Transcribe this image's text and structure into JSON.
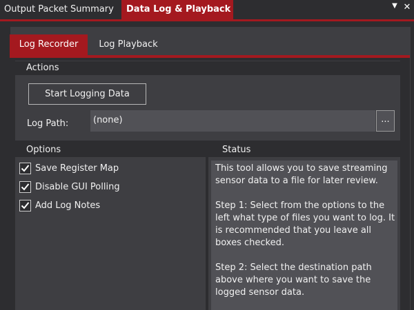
{
  "doc_tabs": [
    {
      "label": "Output Packet Summary",
      "active": false
    },
    {
      "label": "Data Log & Playback",
      "active": true
    }
  ],
  "inner_tabs": [
    {
      "label": "Log Recorder",
      "active": true
    },
    {
      "label": "Log Playback",
      "active": false
    }
  ],
  "actions": {
    "title": "Actions",
    "start_button": "Start Logging Data",
    "log_path_label": "Log Path:",
    "log_path_value": "(none)",
    "browse_button": "..."
  },
  "options": {
    "title": "Options",
    "items": [
      {
        "label": "Save Register Map",
        "checked": true
      },
      {
        "label": "Disable GUI Polling",
        "checked": true
      },
      {
        "label": "Add Log Notes",
        "checked": true
      }
    ]
  },
  "status": {
    "title": "Status",
    "paragraphs": [
      "This tool allows you to save streaming sensor data to a file for later review.",
      "Step 1: Select from the options to the left what type of files you want to log. It is recommended that you leave all boxes checked.",
      "Step 2: Select the destination path above where you want to save the logged sensor data."
    ]
  },
  "colors": {
    "accent": "#a4191f",
    "background": "#2d2d30",
    "panel": "#3e3e42",
    "field": "#515156"
  },
  "icons": {
    "tab_dropdown": "chevron-down-icon",
    "tab_close": "close-icon",
    "checkbox": "check-icon"
  }
}
